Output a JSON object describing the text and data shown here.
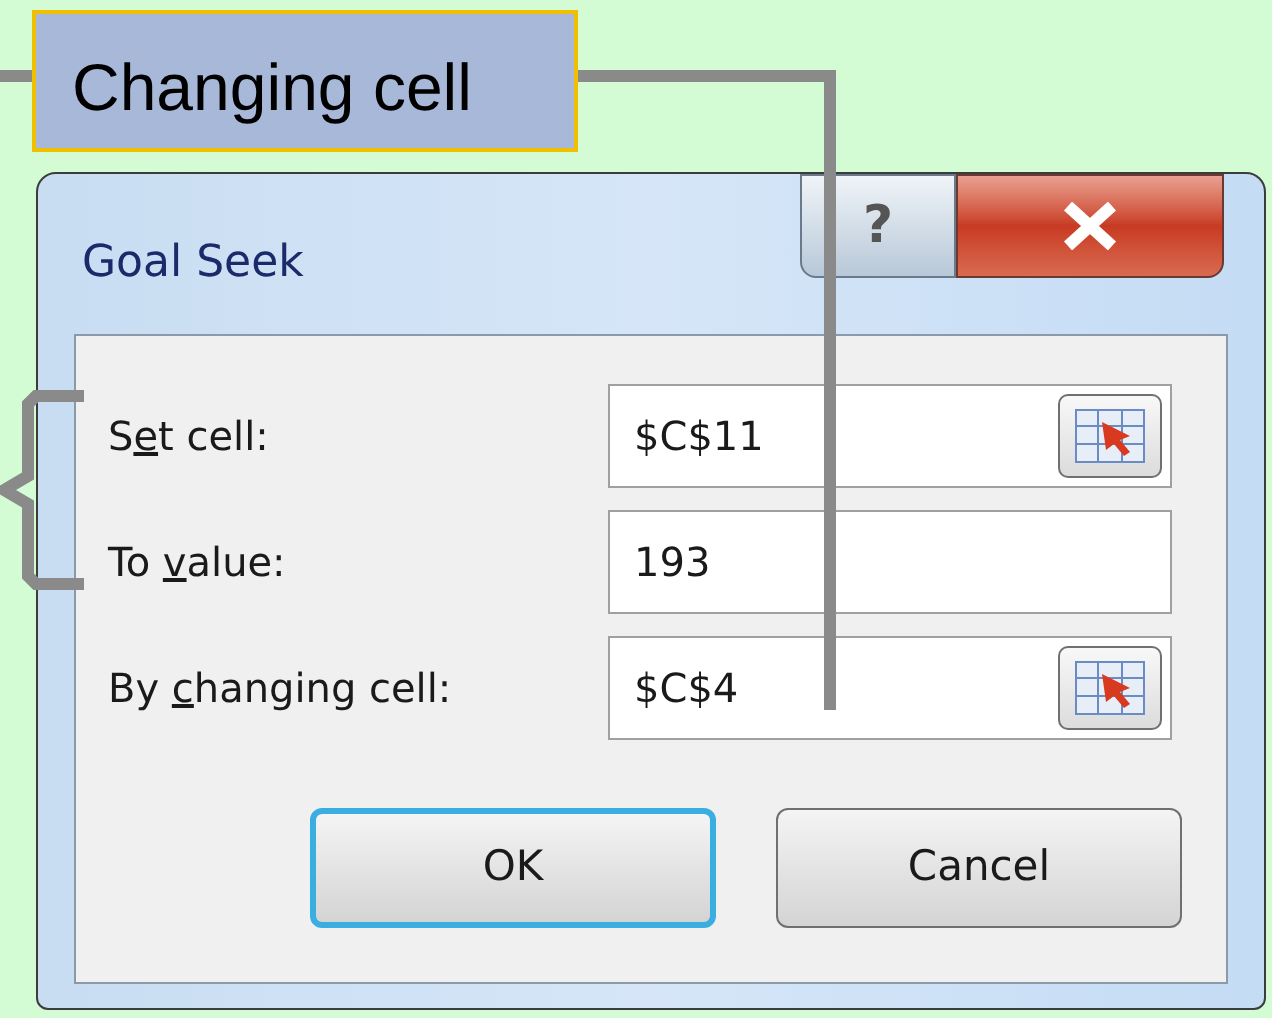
{
  "callout": {
    "text": "Changing cell"
  },
  "window": {
    "title": "Goal Seek",
    "help": "?"
  },
  "fields": [
    {
      "label": {
        "pre": "S",
        "key": "e",
        "post": "t cell:"
      },
      "value": "$C$11",
      "picker": true
    },
    {
      "label": {
        "pre": "To ",
        "key": "v",
        "post": "alue:"
      },
      "value": "193",
      "picker": false
    },
    {
      "label": {
        "pre": "By ",
        "key": "c",
        "post": "hanging cell:"
      },
      "value": "$C$4",
      "picker": true
    }
  ],
  "buttons": [
    {
      "label": "OK",
      "default": true
    },
    {
      "label": "Cancel",
      "default": false
    }
  ]
}
